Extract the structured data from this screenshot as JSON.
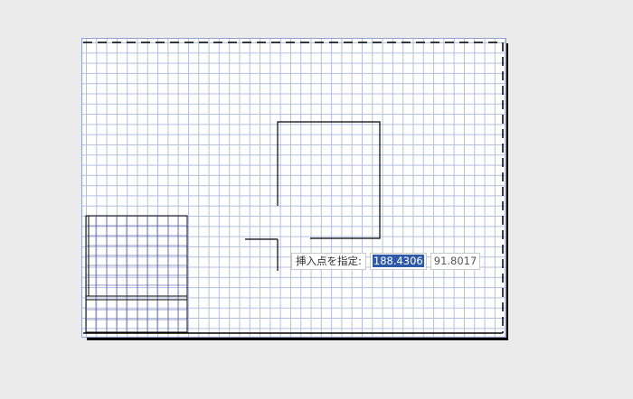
{
  "drawing": {
    "prompt_label": "挿入点を指定:",
    "x_coordinate": "188.4306",
    "y_coordinate": "91.8017"
  },
  "colors": {
    "background": "#ebebeb",
    "grid": "#b4bee0",
    "selection": "#2f5aa8",
    "geometry": "#000000"
  },
  "icons": {
    "cursor": "crosshair-cursor-icon"
  }
}
